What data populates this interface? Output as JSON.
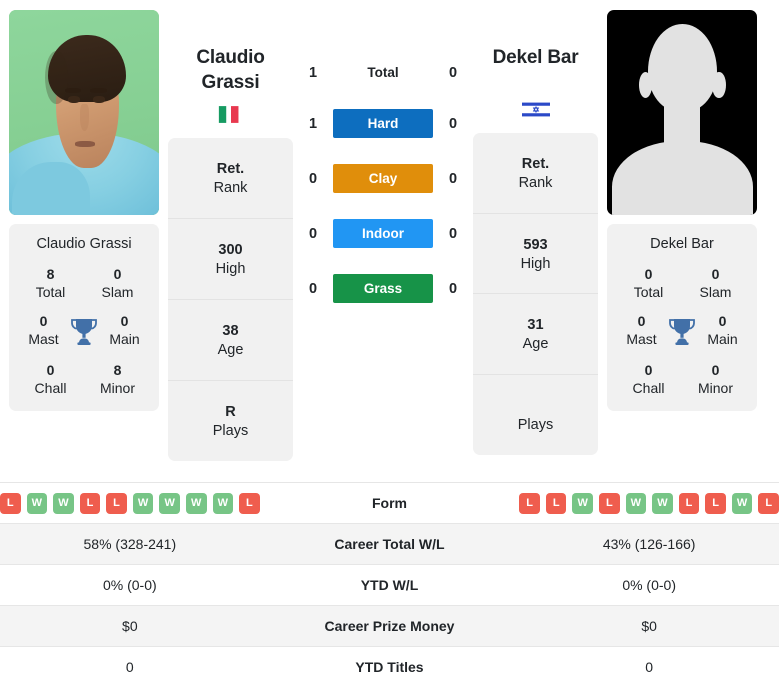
{
  "players": {
    "left": {
      "name": "Claudio Grassi",
      "name_line1": "Claudio",
      "name_line2": "Grassi",
      "country": "Italy",
      "flag_icon": "flag-italy-icon",
      "photo_type": "player-photo",
      "titles": {
        "card_title": "Claudio Grassi",
        "total_value": "8",
        "total_label": "Total",
        "slam_value": "0",
        "slam_label": "Slam",
        "mast_value": "0",
        "mast_label": "Mast",
        "main_value": "0",
        "main_label": "Main",
        "chall_value": "0",
        "chall_label": "Chall",
        "minor_value": "8",
        "minor_label": "Minor",
        "trophy_icon": "trophy-icon"
      },
      "stats": [
        {
          "value": "Ret.",
          "label": "Rank"
        },
        {
          "value": "300",
          "label": "High"
        },
        {
          "value": "38",
          "label": "Age"
        },
        {
          "value": "R",
          "label": "Plays"
        }
      ],
      "form": [
        "L",
        "W",
        "W",
        "L",
        "L",
        "W",
        "W",
        "W",
        "W",
        "L"
      ],
      "career_wl": "58% (328-241)",
      "ytd_wl": "0% (0-0)",
      "prize_money": "$0",
      "ytd_titles": "0"
    },
    "right": {
      "name": "Dekel Bar",
      "name_line1": "Dekel Bar",
      "name_line2": "",
      "country": "Israel",
      "flag_icon": "flag-israel-icon",
      "photo_type": "avatar-placeholder",
      "titles": {
        "card_title": "Dekel Bar",
        "total_value": "0",
        "total_label": "Total",
        "slam_value": "0",
        "slam_label": "Slam",
        "mast_value": "0",
        "mast_label": "Mast",
        "main_value": "0",
        "main_label": "Main",
        "chall_value": "0",
        "chall_label": "Chall",
        "minor_value": "0",
        "minor_label": "Minor",
        "trophy_icon": "trophy-icon"
      },
      "stats": [
        {
          "value": "Ret.",
          "label": "Rank"
        },
        {
          "value": "593",
          "label": "High"
        },
        {
          "value": "31",
          "label": "Age"
        },
        {
          "value": "",
          "label": "Plays"
        }
      ],
      "form": [
        "L",
        "L",
        "W",
        "L",
        "W",
        "W",
        "L",
        "L",
        "W",
        "L"
      ],
      "career_wl": "43% (126-166)",
      "ytd_wl": "0% (0-0)",
      "prize_money": "$0",
      "ytd_titles": "0"
    }
  },
  "head_to_head": [
    {
      "label": "Total",
      "left": "1",
      "right": "0",
      "style": "plain",
      "color": ""
    },
    {
      "label": "Hard",
      "left": "1",
      "right": "0",
      "style": "badge",
      "color": "#0d6ebf"
    },
    {
      "label": "Clay",
      "left": "0",
      "right": "0",
      "style": "badge",
      "color": "#e08e0b"
    },
    {
      "label": "Indoor",
      "left": "0",
      "right": "0",
      "style": "badge",
      "color": "#2196f3"
    },
    {
      "label": "Grass",
      "left": "0",
      "right": "0",
      "style": "badge",
      "color": "#179348"
    }
  ],
  "table": {
    "rows": [
      {
        "label": "Form",
        "left": "",
        "right": "",
        "kind": "form"
      },
      {
        "label": "Career Total W/L",
        "left": "58% (328-241)",
        "right": "43% (126-166)",
        "kind": "text"
      },
      {
        "label": "YTD W/L",
        "left": "0% (0-0)",
        "right": "0% (0-0)",
        "kind": "text"
      },
      {
        "label": "Career Prize Money",
        "left": "$0",
        "right": "$0",
        "kind": "text"
      },
      {
        "label": "YTD Titles",
        "left": "0",
        "right": "0",
        "kind": "text"
      }
    ]
  },
  "colors": {
    "win": "#77c586",
    "loss": "#ef5d4e",
    "card_bg": "#f1f1f1",
    "row_alt_bg": "#f4f4f4"
  }
}
